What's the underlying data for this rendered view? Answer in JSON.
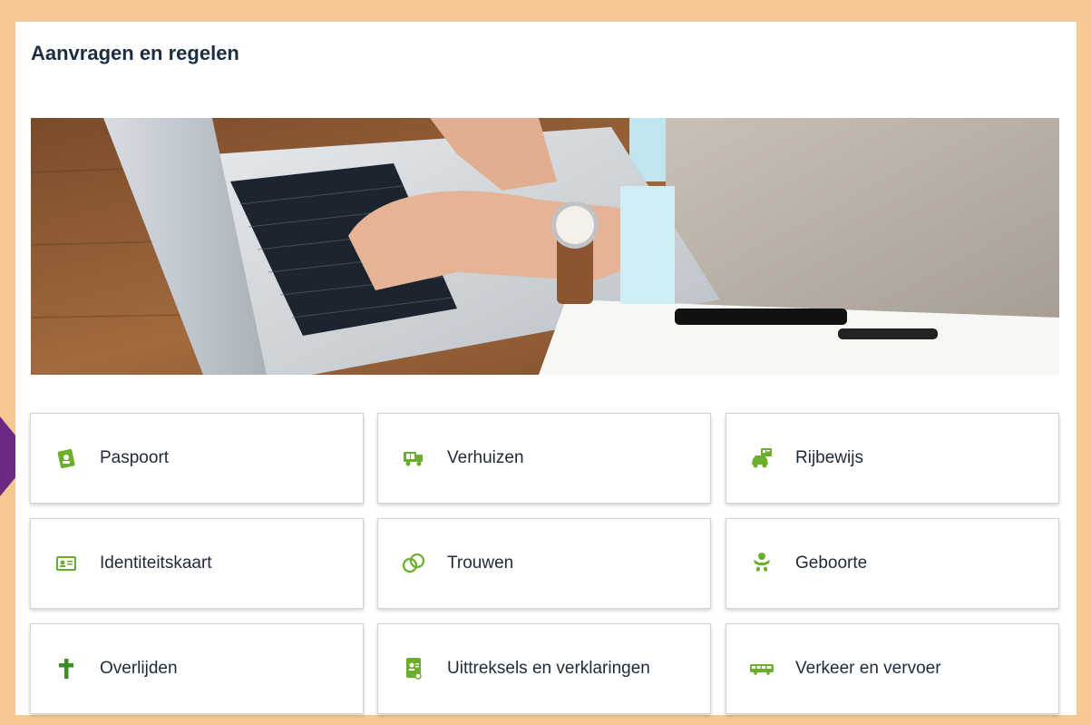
{
  "page": {
    "title": "Aanvragen en regelen"
  },
  "colors": {
    "icon": "#6cae2c",
    "frame": "#f6c992",
    "title": "#1b2d3f",
    "pointer": "#6a2a84"
  },
  "tiles": [
    {
      "label": "Paspoort",
      "icon": "passport-icon"
    },
    {
      "label": "Verhuizen",
      "icon": "moving-truck-icon"
    },
    {
      "label": "Rijbewijs",
      "icon": "driving-license-icon"
    },
    {
      "label": "Identiteitskaart",
      "icon": "id-card-icon"
    },
    {
      "label": "Trouwen",
      "icon": "wedding-rings-icon"
    },
    {
      "label": "Geboorte",
      "icon": "baby-icon"
    },
    {
      "label": "Overlijden",
      "icon": "cross-icon"
    },
    {
      "label": "Uittreksels en verklaringen",
      "icon": "document-icon"
    },
    {
      "label": "Verkeer en vervoer",
      "icon": "bus-icon"
    }
  ]
}
